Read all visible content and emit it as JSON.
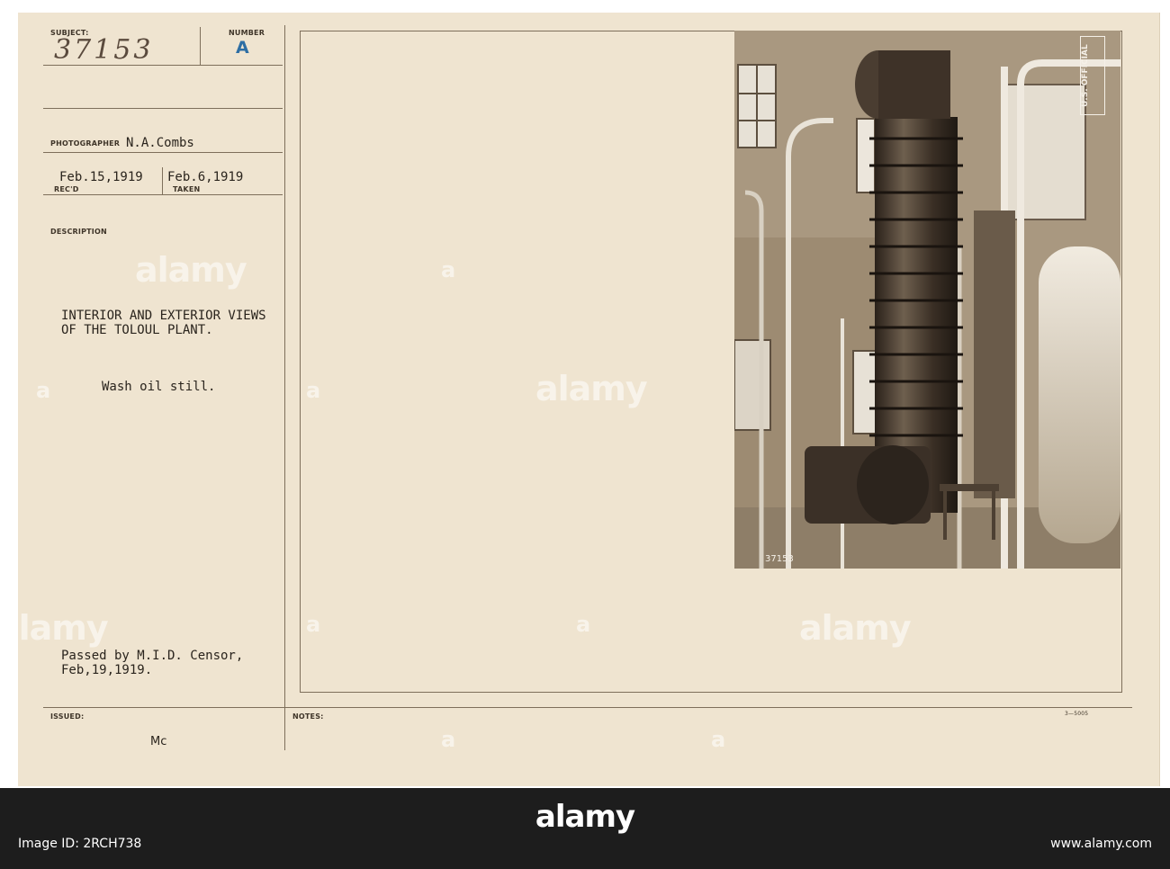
{
  "card": {
    "subject_label": "SUBJECT:",
    "subject_number": "37153",
    "number_label": "NUMBER",
    "number_value": "A",
    "photographer_label": "PHOTOGRAPHER",
    "photographer": "N.A.Combs",
    "received_date": "Feb.15,1919",
    "received_label": "REC'D",
    "taken_date": "Feb.6,1919",
    "taken_label": "TAKEN",
    "description_label": "DESCRIPTION",
    "description_line1": "INTERIOR AND EXTERIOR VIEWS",
    "description_line2": "OF THE TOLOUL PLANT.",
    "caption": "Wash oil still.",
    "censor_line1": "Passed by M.I.D. Censor,",
    "censor_line2": "Feb,19,1919.",
    "issued_label": "ISSUED:",
    "issued_initials": "Mc",
    "notes_label": "NOTES:",
    "form_number": "3—5005"
  },
  "photo": {
    "official_stamp": "U.S. OFFICIAL",
    "negative_number": "37153"
  },
  "watermark": {
    "text": "alamy",
    "mark": "a"
  },
  "footer": {
    "brand": "alamy",
    "image_id": "Image ID: 2RCH738",
    "url": "www.alamy.com"
  }
}
